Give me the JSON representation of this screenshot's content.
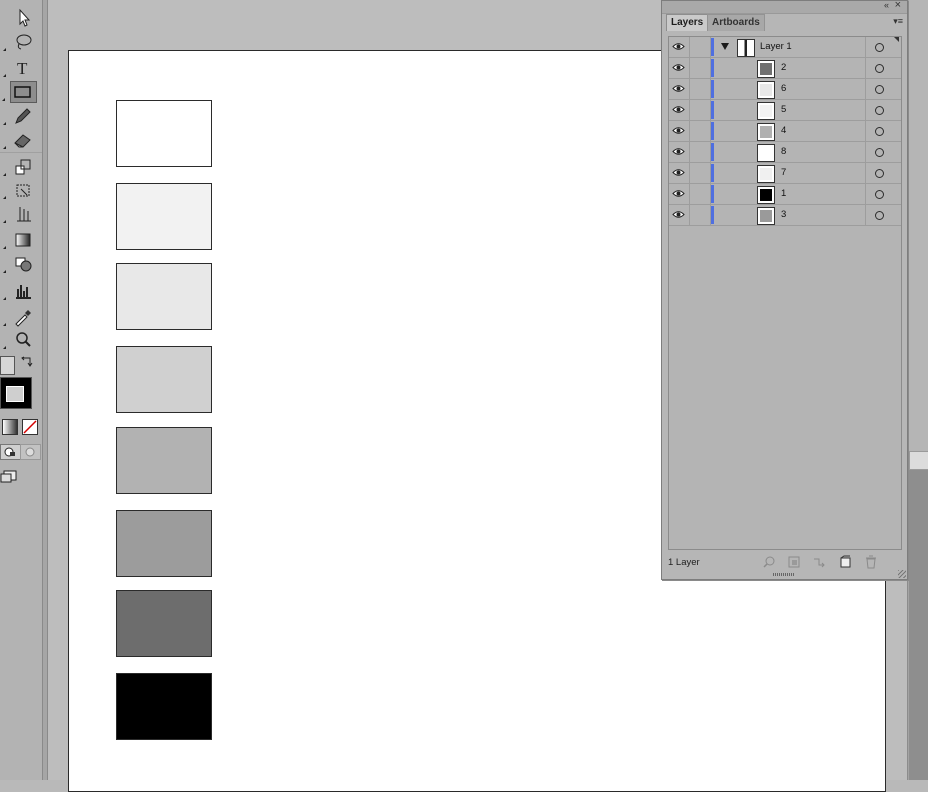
{
  "panel": {
    "tabs": [
      {
        "label": "Layers"
      },
      {
        "label": "Artboards"
      }
    ],
    "collapse_glyph": "«",
    "close_glyph": "×",
    "menu_glyph": "▾≡",
    "layers": [
      {
        "name": "Layer 1",
        "type": "layer",
        "expanded": true,
        "thumb_color": "#ffffff"
      },
      {
        "name": "2",
        "type": "sub",
        "thumb_color": "#707070"
      },
      {
        "name": "6",
        "type": "sub",
        "thumb_color": "#e8e8e8"
      },
      {
        "name": "5",
        "type": "sub",
        "thumb_color": "#f2f2f2"
      },
      {
        "name": "4",
        "type": "sub",
        "thumb_color": "#b0b0b0"
      },
      {
        "name": "8",
        "type": "sub",
        "thumb_color": "#ffffff"
      },
      {
        "name": "7",
        "type": "sub",
        "thumb_color": "#f0f0f0"
      },
      {
        "name": "1",
        "type": "sub",
        "thumb_color": "#000000"
      },
      {
        "name": "3",
        "type": "sub",
        "thumb_color": "#9a9a9a"
      }
    ],
    "layer_color": "#4f6fe0",
    "footer_count": "1 Layer",
    "footer_buttons": [
      "locate-object-icon",
      "make-clipping-mask-icon",
      "create-sublayer-icon",
      "create-new-layer-icon",
      "delete-icon"
    ]
  },
  "tools": [
    "selection-tool-icon",
    "lasso-tool-icon",
    "type-tool-icon",
    "rectangle-tool-icon",
    "pencil-tool-icon",
    "eraser-tool-icon",
    "scale-tool-icon",
    "free-transform-tool-icon",
    "symbol-sprayer-tool-icon",
    "gradient-tool-icon",
    "shape-builder-tool-icon",
    "column-graph-tool-icon",
    "eyedropper-tool-icon",
    "zoom-tool-icon"
  ],
  "artboard": {
    "swatches": [
      {
        "name": "swatch-white",
        "color": "#ffffff"
      },
      {
        "name": "swatch-very-light-gray",
        "color": "#f2f2f2"
      },
      {
        "name": "swatch-light-gray",
        "color": "#e8e8e8"
      },
      {
        "name": "swatch-gray-20",
        "color": "#d0d0d0"
      },
      {
        "name": "swatch-gray-30",
        "color": "#b2b2b2"
      },
      {
        "name": "swatch-gray-40",
        "color": "#9c9c9c"
      },
      {
        "name": "swatch-dark-gray",
        "color": "#6d6d6d"
      },
      {
        "name": "swatch-black",
        "color": "#000000"
      }
    ]
  }
}
